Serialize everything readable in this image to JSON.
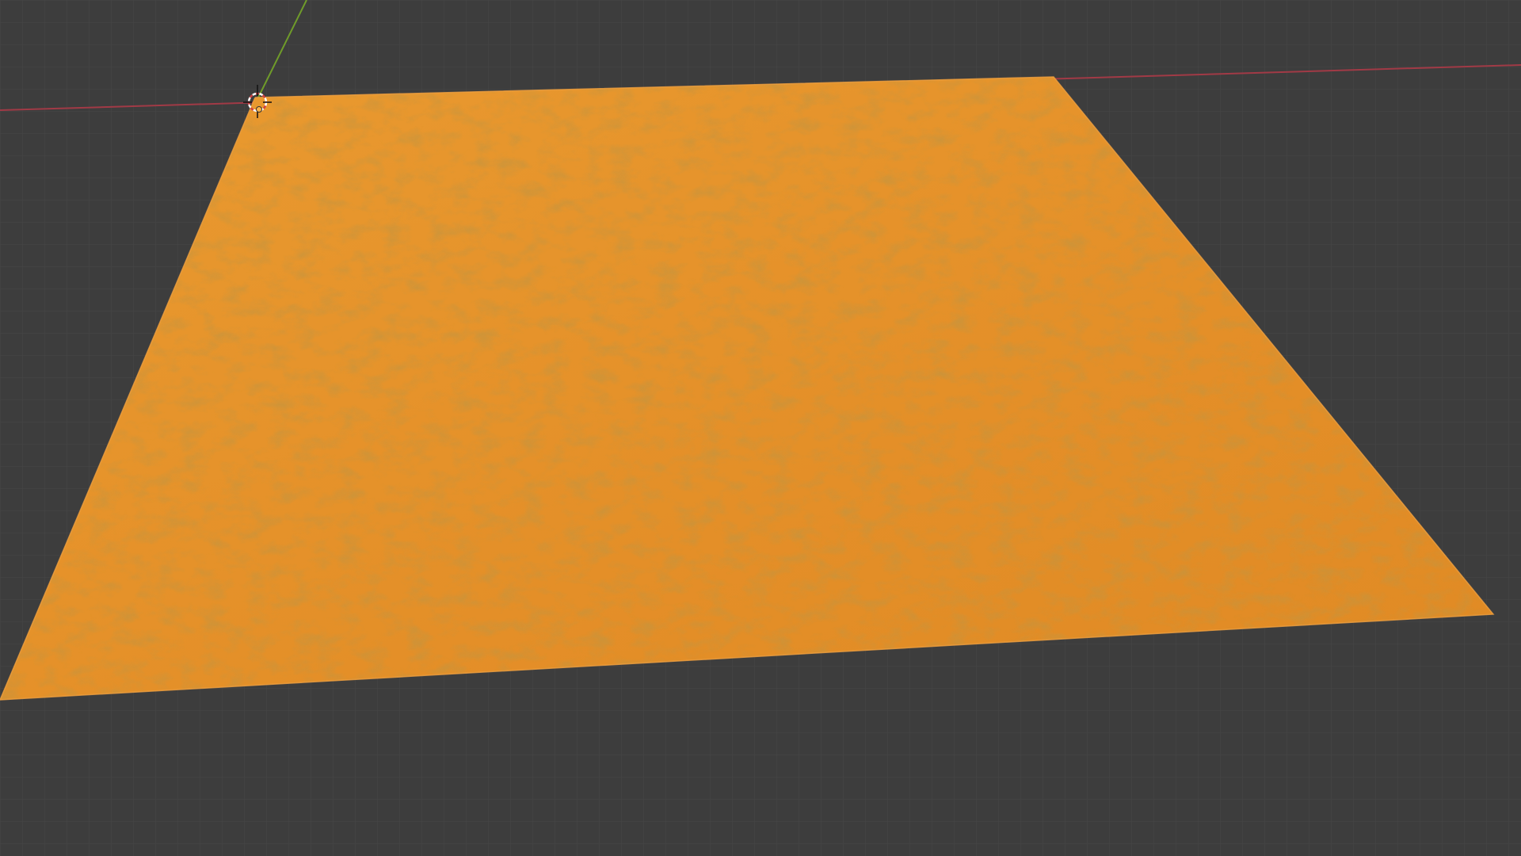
{
  "app": {
    "view": "3D Viewport",
    "object_type": "terrain mesh",
    "selected": true
  },
  "colors": {
    "background": "#3d3d3d",
    "grid_line": "#4a4a4a",
    "x_axis": "#a13a46",
    "y_axis": "#6f9b2a",
    "selection_orange": "#e8912c",
    "terrain_shade": "#c97a20",
    "cursor_white": "#ffffff",
    "cursor_red": "#d04040"
  },
  "icons": {
    "cursor": "3d-cursor-icon",
    "origin": "object-origin-icon"
  }
}
